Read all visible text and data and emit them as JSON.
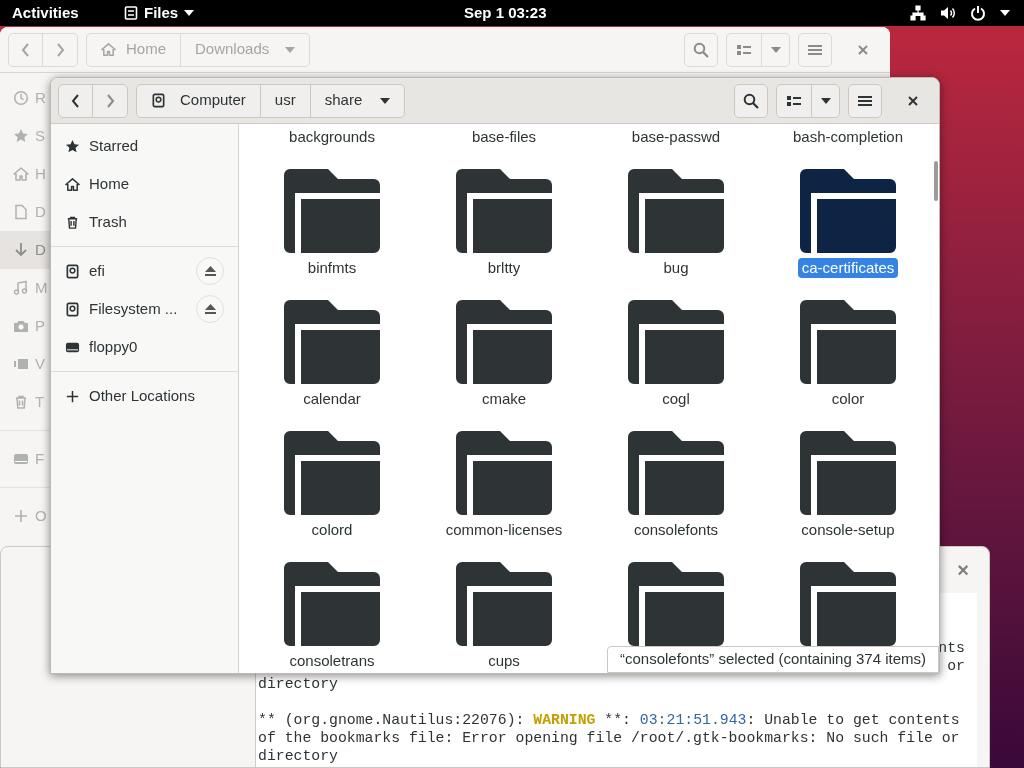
{
  "top_bar": {
    "activities": "Activities",
    "app_menu": "Files",
    "clock": "Sep 1 03:23"
  },
  "back_window": {
    "path": [
      {
        "label": "Home",
        "kind": "home"
      },
      {
        "label": "Downloads",
        "kind": "dropdown"
      }
    ],
    "sidebar": [
      {
        "label": "R",
        "kind": "recent",
        "selected": false
      },
      {
        "label": "S",
        "kind": "star",
        "selected": false
      },
      {
        "label": "H",
        "kind": "home",
        "selected": false
      },
      {
        "label": "D",
        "kind": "document",
        "selected": false
      },
      {
        "label": "D",
        "kind": "download",
        "selected": true
      },
      {
        "label": "M",
        "kind": "music",
        "selected": false
      },
      {
        "label": "P",
        "kind": "camera",
        "selected": false
      },
      {
        "label": "V",
        "kind": "video",
        "selected": false
      },
      {
        "label": "T",
        "kind": "trash",
        "selected": false
      },
      {
        "label": "F",
        "kind": "drive",
        "selected": false
      },
      {
        "label": "O",
        "kind": "plus",
        "selected": false
      }
    ]
  },
  "terminal": {
    "close": "×",
    "lines": [
      {
        "kind": "right",
        "segments": [
          {
            "text": "nts",
            "kind": "plain"
          }
        ]
      },
      {
        "kind": "right",
        "segments": [
          {
            "text": "or",
            "kind": "plain"
          }
        ]
      },
      {
        "kind": "normal",
        "segments": [
          {
            "text": "directory",
            "kind": "plain"
          }
        ]
      },
      {
        "kind": "spaced",
        "segments": [
          {
            "text": "** (org.gnome.Nautilus:22076): ",
            "kind": "plain"
          },
          {
            "text": "WARNING",
            "kind": "warning"
          },
          {
            "text": " **: ",
            "kind": "plain"
          },
          {
            "text": "03:21:51.943",
            "kind": "time"
          },
          {
            "text": ": Unable to get contents",
            "kind": "plain"
          }
        ]
      },
      {
        "kind": "normal",
        "segments": [
          {
            "text": "of the bookmarks file: Error opening file /root/.gtk-bookmarks: No such file or",
            "kind": "plain"
          }
        ]
      },
      {
        "kind": "normal",
        "segments": [
          {
            "text": "directory",
            "kind": "plain"
          }
        ]
      }
    ]
  },
  "window": {
    "path": [
      {
        "label": "Computer",
        "kind": "disk"
      },
      {
        "label": "usr",
        "kind": "plain"
      },
      {
        "label": "share",
        "kind": "dropdown"
      }
    ],
    "sidebar": [
      [
        {
          "label": "Starred",
          "kind": "star",
          "ejectable": false
        },
        {
          "label": "Home",
          "kind": "home",
          "ejectable": false
        },
        {
          "label": "Trash",
          "kind": "trash",
          "ejectable": false
        }
      ],
      [
        {
          "label": "efi",
          "kind": "disk",
          "ejectable": true
        },
        {
          "label": "Filesystem ...",
          "kind": "disk",
          "ejectable": true
        },
        {
          "label": "floppy0",
          "kind": "drive",
          "ejectable": false
        }
      ],
      [
        {
          "label": "Other Locations",
          "kind": "plus",
          "ejectable": false
        }
      ]
    ],
    "files": [
      {
        "name": "backgrounds",
        "selected": false
      },
      {
        "name": "base-files",
        "selected": false
      },
      {
        "name": "base-passwd",
        "selected": false
      },
      {
        "name": "bash-completion",
        "selected": false
      },
      {
        "name": "binfmts",
        "selected": false
      },
      {
        "name": "brltty",
        "selected": false
      },
      {
        "name": "bug",
        "selected": false
      },
      {
        "name": "ca-certificates",
        "selected": true
      },
      {
        "name": "calendar",
        "selected": false
      },
      {
        "name": "cmake",
        "selected": false
      },
      {
        "name": "cogl",
        "selected": false
      },
      {
        "name": "color",
        "selected": false
      },
      {
        "name": "colord",
        "selected": false
      },
      {
        "name": "common-licenses",
        "selected": false
      },
      {
        "name": "consolefonts",
        "selected": false
      },
      {
        "name": "console-setup",
        "selected": false
      },
      {
        "name": "consoletrans",
        "selected": false
      },
      {
        "name": "cups",
        "selected": false
      },
      {
        "selected": false
      },
      {
        "selected": false
      }
    ],
    "status": "“consolefonts” selected (containing 374 items)"
  }
}
